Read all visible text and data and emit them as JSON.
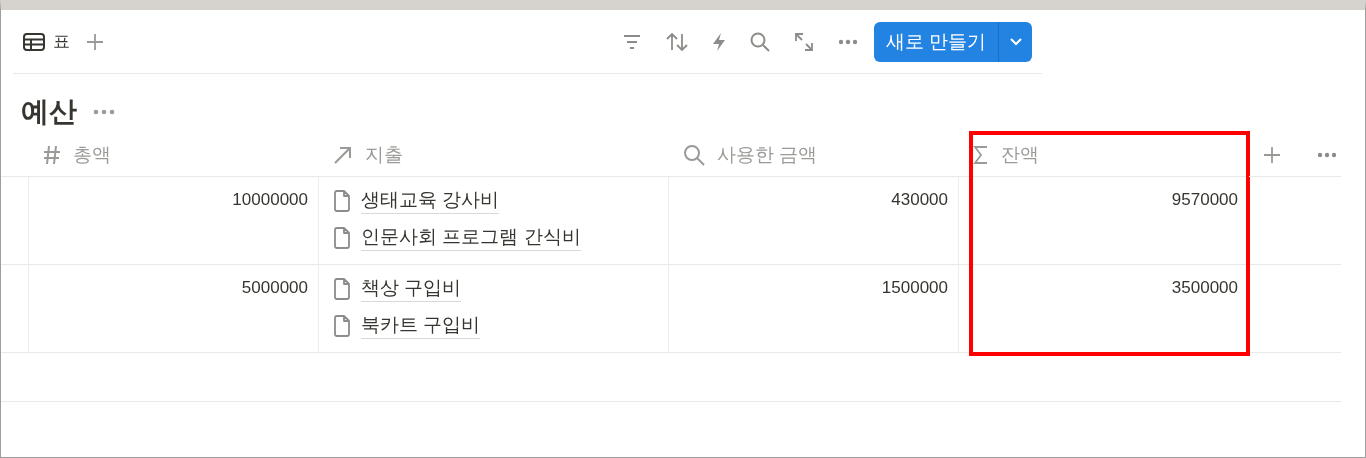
{
  "toolbar": {
    "view_tab": {
      "label": "표",
      "selected": true
    },
    "new_button": {
      "label": "새로 만들기"
    }
  },
  "database": {
    "title": "예산"
  },
  "table": {
    "columns": [
      {
        "label": "총액",
        "kind": "number",
        "highlighted": false
      },
      {
        "label": "지출",
        "kind": "relation",
        "highlighted": false
      },
      {
        "label": "사용한 금액",
        "kind": "rollup",
        "highlighted": false
      },
      {
        "label": "잔액",
        "kind": "formula",
        "highlighted": true
      }
    ],
    "rows": [
      {
        "total": "10000000",
        "expenses": [
          "생태교육 강사비",
          "인문사회 프로그램 간식비"
        ],
        "used": "430000",
        "balance": "9570000"
      },
      {
        "total": "5000000",
        "expenses": [
          "책상 구입비",
          "북카트 구입비"
        ],
        "used": "1500000",
        "balance": "3500000"
      }
    ]
  }
}
